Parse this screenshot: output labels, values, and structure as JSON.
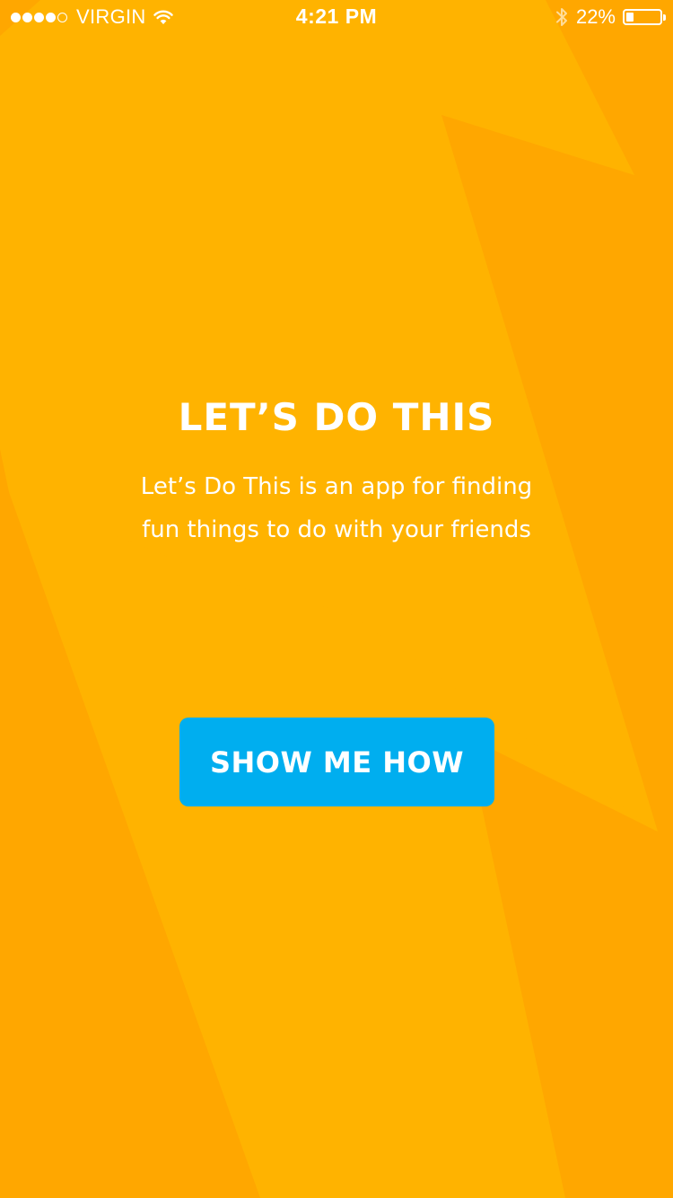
{
  "status_bar": {
    "carrier": "VIRGIN",
    "signal_bars": 4,
    "signal_total": 5,
    "time": "4:21 PM",
    "battery_percent_label": "22%",
    "battery_level": 0.22
  },
  "hero": {
    "title": "LET’S DO THIS",
    "subtitle_line1": "Let’s Do This is an app for finding",
    "subtitle_line2": "fun things to do with your friends"
  },
  "cta": {
    "label": "SHOW ME HOW"
  },
  "colors": {
    "background": "#FFA700",
    "background_shape": "#FFB300",
    "button": "#00AEEF",
    "text": "#FFFFFF"
  },
  "icons": {
    "wifi": "wifi-icon",
    "bluetooth": "bluetooth-icon",
    "battery": "battery-icon"
  }
}
